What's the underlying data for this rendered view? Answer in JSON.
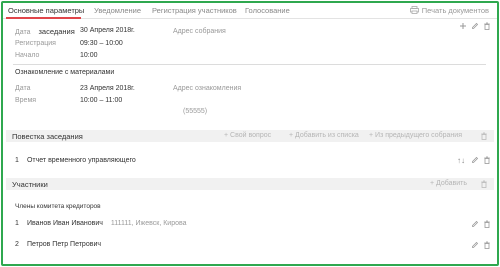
{
  "tabs": [
    {
      "label": "Основные параметры"
    },
    {
      "label": "Уведомление"
    },
    {
      "label": "Регистрация участников"
    },
    {
      "label": "Голосование"
    }
  ],
  "print_label": "Печать документов",
  "meeting": {
    "date_label": "Дата",
    "date_suffix": "заседания",
    "date_value": "30 Апреля 2018г.",
    "registration_label": "Регистрация",
    "registration_value": "09:30 – 10:00",
    "start_label": "Начало",
    "start_value": "10:00",
    "address_label": "Адрес собрания"
  },
  "materials": {
    "title": "Ознакомление с материалами",
    "date_label": "Дата",
    "date_value": "23 Апреля 2018г.",
    "time_label": "Время",
    "time_value": "10:00 – 11:00",
    "address_label": "Адрес ознакомления",
    "address_value": "(55555)"
  },
  "agenda": {
    "title": "Повестка заседания",
    "own_question": "Свой вопрос",
    "add_from_list": "Добавить из списка",
    "from_previous": "Из предыдущего собрания",
    "items": [
      {
        "num": "1",
        "text": "Отчет временного управляющего"
      }
    ]
  },
  "participants": {
    "title": "Участники",
    "add_label": "Добавить",
    "group_title": "Члены комитета кредиторов",
    "items": [
      {
        "num": "1",
        "name": "Иванов Иван Иванович",
        "note": "111111, Ижевск, Кирова"
      },
      {
        "num": "2",
        "name": "Петров Петр Петрович",
        "note": ""
      }
    ]
  },
  "colors": {
    "accent": "#e0454a",
    "frame": "#2fa84f",
    "bar": "#f1f1f1"
  }
}
